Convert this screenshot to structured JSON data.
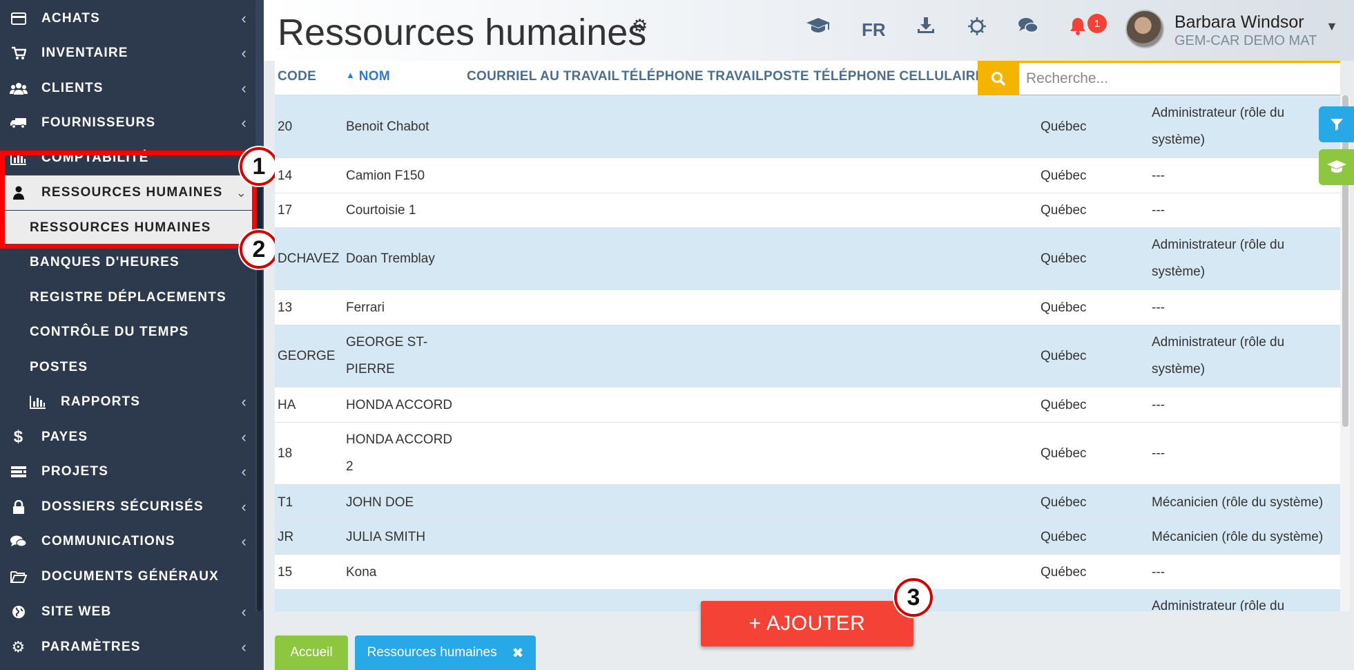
{
  "sidebar": {
    "items": [
      {
        "icon": "credit-card-icon",
        "label": "ACHATS"
      },
      {
        "icon": "cart-icon",
        "label": "INVENTAIRE"
      },
      {
        "icon": "users-icon",
        "label": "CLIENTS"
      },
      {
        "icon": "truck-icon",
        "label": "FOURNISSEURS"
      },
      {
        "icon": "bar-chart-icon",
        "label": "COMPTABILITÉ"
      },
      {
        "icon": "user-icon",
        "label": "RESSOURCES HUMAINES"
      },
      {
        "label": "RESSOURCES HUMAINES"
      },
      {
        "label": "BANQUES D'HEURES"
      },
      {
        "label": "REGISTRE DÉPLACEMENTS"
      },
      {
        "label": "CONTRÔLE DU TEMPS"
      },
      {
        "label": "POSTES"
      },
      {
        "icon": "bar-chart-icon",
        "label": "RAPPORTS"
      },
      {
        "icon": "dollar-icon",
        "label": "PAYES"
      },
      {
        "icon": "projects-icon",
        "label": "PROJETS"
      },
      {
        "icon": "lock-icon",
        "label": "DOSSIERS SÉCURISÉS"
      },
      {
        "icon": "comments-icon",
        "label": "COMMUNICATIONS"
      },
      {
        "icon": "folder-open-icon",
        "label": "DOCUMENTS GÉNÉRAUX"
      },
      {
        "icon": "globe-icon",
        "label": "SITE WEB"
      },
      {
        "icon": "gear-icon",
        "label": "PARAMÈTRES"
      }
    ]
  },
  "annotations": {
    "step1": "1",
    "step2": "2",
    "step3": "3"
  },
  "header": {
    "title": "Ressources humaines",
    "lang": "FR",
    "notif_count": "1",
    "user_name": "Barbara Windsor",
    "user_company": "GEM-CAR DEMO MAT"
  },
  "table": {
    "columns": {
      "code": "CODE",
      "nom": "NOM",
      "email": "COURRIEL AU TRAVAIL",
      "phone": "TÉLÉPHONE TRAVAIL",
      "poste": "POSTE",
      "cell": "TÉLÉPHONE CELLULAIRE"
    },
    "search_placeholder": "Recherche...",
    "rows": [
      {
        "code": "20",
        "nom": "Benoit Chabot",
        "prov": "Québec",
        "role": "Administrateur (rôle du système)"
      },
      {
        "code": "14",
        "nom": "Camion F150",
        "prov": "Québec",
        "role": "---"
      },
      {
        "code": "17",
        "nom": "Courtoisie 1",
        "prov": "Québec",
        "role": "---"
      },
      {
        "code": "DCHAVEZ",
        "nom": "Doan Tremblay",
        "prov": "Québec",
        "role": "Administrateur (rôle du système)"
      },
      {
        "code": "13",
        "nom": "Ferrari",
        "prov": "Québec",
        "role": "---"
      },
      {
        "code": "GEORGE",
        "nom": "GEORGE ST-PIERRE",
        "prov": "Québec",
        "role": "Administrateur (rôle du système)"
      },
      {
        "code": "HA",
        "nom": "HONDA ACCORD",
        "prov": "Québec",
        "role": "---"
      },
      {
        "code": "18",
        "nom": "HONDA ACCORD 2",
        "prov": "Québec",
        "role": "---"
      },
      {
        "code": "T1",
        "nom": "JOHN DOE",
        "prov": "Québec",
        "role": "Mécanicien (rôle du système)"
      },
      {
        "code": "JR",
        "nom": "JULIA SMITH",
        "prov": "Québec",
        "role": "Mécanicien (rôle du système)"
      },
      {
        "code": "15",
        "nom": "Kona",
        "prov": "Québec",
        "role": "---"
      },
      {
        "code": "",
        "nom": "",
        "prov": "",
        "role": "Administrateur (rôle du"
      }
    ]
  },
  "actions": {
    "add_label": "+ AJOUTER"
  },
  "footer_tabs": {
    "home": "Accueil",
    "hr": "Ressources humaines",
    "close": "✖"
  },
  "colors": {
    "sidebar_bg": "#2d3a4e",
    "accent_red": "#f44336",
    "highlight": "#ff0000",
    "search_yellow": "#f4b400",
    "row_alt": "#d6e8f3",
    "tab_green": "#8dc63f",
    "tab_blue": "#27a9e8"
  }
}
